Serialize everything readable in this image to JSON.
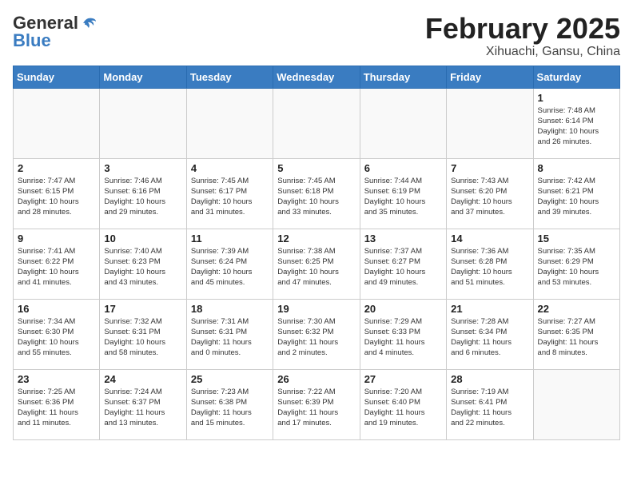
{
  "header": {
    "logo_general": "General",
    "logo_blue": "Blue",
    "month_year": "February 2025",
    "location": "Xihuachi, Gansu, China"
  },
  "weekdays": [
    "Sunday",
    "Monday",
    "Tuesday",
    "Wednesday",
    "Thursday",
    "Friday",
    "Saturday"
  ],
  "weeks": [
    [
      {
        "day": "",
        "info": ""
      },
      {
        "day": "",
        "info": ""
      },
      {
        "day": "",
        "info": ""
      },
      {
        "day": "",
        "info": ""
      },
      {
        "day": "",
        "info": ""
      },
      {
        "day": "",
        "info": ""
      },
      {
        "day": "1",
        "info": "Sunrise: 7:48 AM\nSunset: 6:14 PM\nDaylight: 10 hours\nand 26 minutes."
      }
    ],
    [
      {
        "day": "2",
        "info": "Sunrise: 7:47 AM\nSunset: 6:15 PM\nDaylight: 10 hours\nand 28 minutes."
      },
      {
        "day": "3",
        "info": "Sunrise: 7:46 AM\nSunset: 6:16 PM\nDaylight: 10 hours\nand 29 minutes."
      },
      {
        "day": "4",
        "info": "Sunrise: 7:45 AM\nSunset: 6:17 PM\nDaylight: 10 hours\nand 31 minutes."
      },
      {
        "day": "5",
        "info": "Sunrise: 7:45 AM\nSunset: 6:18 PM\nDaylight: 10 hours\nand 33 minutes."
      },
      {
        "day": "6",
        "info": "Sunrise: 7:44 AM\nSunset: 6:19 PM\nDaylight: 10 hours\nand 35 minutes."
      },
      {
        "day": "7",
        "info": "Sunrise: 7:43 AM\nSunset: 6:20 PM\nDaylight: 10 hours\nand 37 minutes."
      },
      {
        "day": "8",
        "info": "Sunrise: 7:42 AM\nSunset: 6:21 PM\nDaylight: 10 hours\nand 39 minutes."
      }
    ],
    [
      {
        "day": "9",
        "info": "Sunrise: 7:41 AM\nSunset: 6:22 PM\nDaylight: 10 hours\nand 41 minutes."
      },
      {
        "day": "10",
        "info": "Sunrise: 7:40 AM\nSunset: 6:23 PM\nDaylight: 10 hours\nand 43 minutes."
      },
      {
        "day": "11",
        "info": "Sunrise: 7:39 AM\nSunset: 6:24 PM\nDaylight: 10 hours\nand 45 minutes."
      },
      {
        "day": "12",
        "info": "Sunrise: 7:38 AM\nSunset: 6:25 PM\nDaylight: 10 hours\nand 47 minutes."
      },
      {
        "day": "13",
        "info": "Sunrise: 7:37 AM\nSunset: 6:27 PM\nDaylight: 10 hours\nand 49 minutes."
      },
      {
        "day": "14",
        "info": "Sunrise: 7:36 AM\nSunset: 6:28 PM\nDaylight: 10 hours\nand 51 minutes."
      },
      {
        "day": "15",
        "info": "Sunrise: 7:35 AM\nSunset: 6:29 PM\nDaylight: 10 hours\nand 53 minutes."
      }
    ],
    [
      {
        "day": "16",
        "info": "Sunrise: 7:34 AM\nSunset: 6:30 PM\nDaylight: 10 hours\nand 55 minutes."
      },
      {
        "day": "17",
        "info": "Sunrise: 7:32 AM\nSunset: 6:31 PM\nDaylight: 10 hours\nand 58 minutes."
      },
      {
        "day": "18",
        "info": "Sunrise: 7:31 AM\nSunset: 6:31 PM\nDaylight: 11 hours\nand 0 minutes."
      },
      {
        "day": "19",
        "info": "Sunrise: 7:30 AM\nSunset: 6:32 PM\nDaylight: 11 hours\nand 2 minutes."
      },
      {
        "day": "20",
        "info": "Sunrise: 7:29 AM\nSunset: 6:33 PM\nDaylight: 11 hours\nand 4 minutes."
      },
      {
        "day": "21",
        "info": "Sunrise: 7:28 AM\nSunset: 6:34 PM\nDaylight: 11 hours\nand 6 minutes."
      },
      {
        "day": "22",
        "info": "Sunrise: 7:27 AM\nSunset: 6:35 PM\nDaylight: 11 hours\nand 8 minutes."
      }
    ],
    [
      {
        "day": "23",
        "info": "Sunrise: 7:25 AM\nSunset: 6:36 PM\nDaylight: 11 hours\nand 11 minutes."
      },
      {
        "day": "24",
        "info": "Sunrise: 7:24 AM\nSunset: 6:37 PM\nDaylight: 11 hours\nand 13 minutes."
      },
      {
        "day": "25",
        "info": "Sunrise: 7:23 AM\nSunset: 6:38 PM\nDaylight: 11 hours\nand 15 minutes."
      },
      {
        "day": "26",
        "info": "Sunrise: 7:22 AM\nSunset: 6:39 PM\nDaylight: 11 hours\nand 17 minutes."
      },
      {
        "day": "27",
        "info": "Sunrise: 7:20 AM\nSunset: 6:40 PM\nDaylight: 11 hours\nand 19 minutes."
      },
      {
        "day": "28",
        "info": "Sunrise: 7:19 AM\nSunset: 6:41 PM\nDaylight: 11 hours\nand 22 minutes."
      },
      {
        "day": "",
        "info": ""
      }
    ]
  ]
}
